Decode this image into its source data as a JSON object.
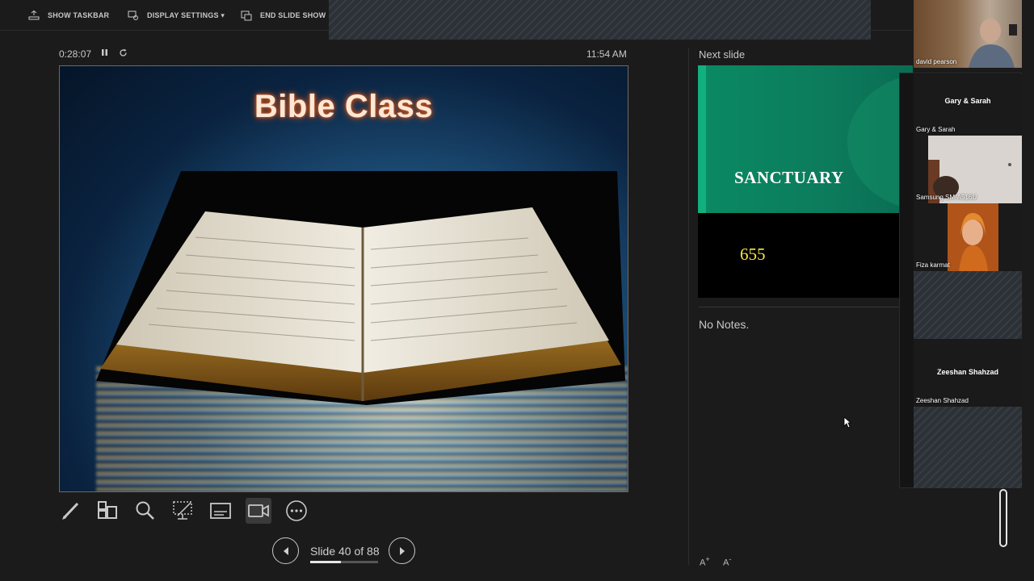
{
  "toolbar": {
    "show_taskbar": "SHOW TASKBAR",
    "display_settings": "DISPLAY SETTINGS ▾",
    "end_slide_show": "END SLIDE SHOW"
  },
  "presenter": {
    "elapsed": "0:28:07",
    "clock": "11:54 AM",
    "slide_title": "Bible Class",
    "slide_counter": "Slide 40 of 88",
    "progress": 0.45
  },
  "next": {
    "label": "Next slide",
    "title": "SANCTUARY",
    "number": "655"
  },
  "notes": {
    "text": "No Notes."
  },
  "participants": {
    "self": "david pearson",
    "gary_center": "Gary & Sarah",
    "gary_name": "Gary & Sarah",
    "samsung": "Samsung SM-A516U",
    "fiza": "Fiza karmat",
    "zeeshan_center": "Zeeshan Shahzad",
    "zeeshan_name": "Zeeshan Shahzad"
  },
  "font_controls": {
    "increase": "A",
    "decrease": "A"
  },
  "icons": [
    "taskbar-icon",
    "display-settings-icon",
    "end-show-icon",
    "pause-icon",
    "restart-icon",
    "pen-icon",
    "slides-grid-icon",
    "zoom-icon",
    "pointer-icon",
    "subtitles-icon",
    "camera-icon",
    "more-icon",
    "prev-icon",
    "next-icon"
  ],
  "colors": {
    "background": "#1b1b1b",
    "next_slide_green": "#0c7b5c",
    "next_number_yellow": "#f5e84a",
    "title_glow": "#c8531c"
  }
}
